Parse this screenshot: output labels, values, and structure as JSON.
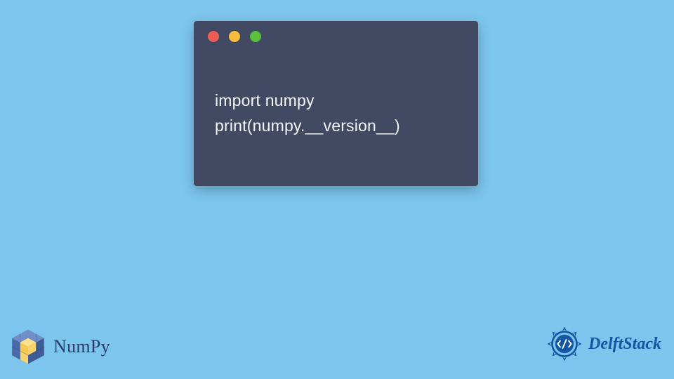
{
  "code": {
    "line1": "import numpy",
    "line2": "print(numpy.__version__)"
  },
  "brand_numpy": {
    "label": "NumPy"
  },
  "brand_delft": {
    "label": "DelftStack"
  },
  "colors": {
    "bg": "#7cc6ee",
    "window": "#414963",
    "dot_red": "#ee5c54",
    "dot_yellow": "#f6bc3d",
    "dot_green": "#5dc13f",
    "numpy_fill": "#f9d36b",
    "numpy_side": "#4a6aa8",
    "delft_blue": "#1356a4"
  }
}
